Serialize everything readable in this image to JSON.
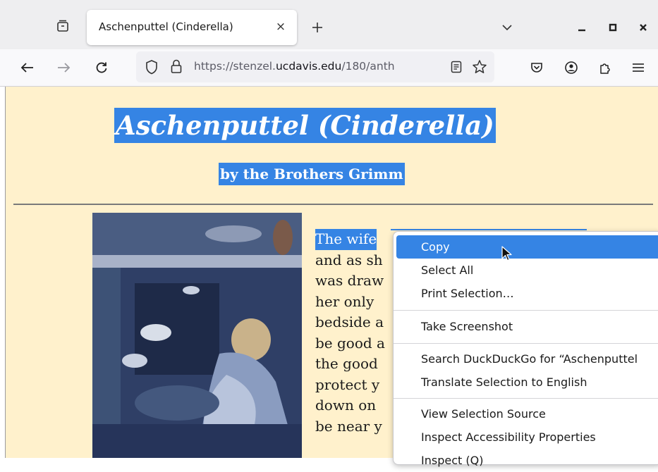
{
  "browser": {
    "tab": {
      "title": "Aschenputtel (Cinderella)",
      "close_glyph": "×"
    },
    "new_tab_glyph": "+",
    "list_all_tabs_glyph": "⌄",
    "url": {
      "prefix": "https://stenzel.",
      "host": "ucdavis.edu",
      "path": "/180/anth"
    }
  },
  "page": {
    "title": "Aschenputtel (Cinderella)",
    "subtitle": "by the Brothers Grimm",
    "story_first_word": "The wife",
    "story_lines": [
      "and as sh",
      "was draw",
      "her only",
      "bedside a",
      "be good a",
      "the good",
      "protect y",
      "down on",
      "be near y"
    ]
  },
  "context_menu": {
    "items": {
      "copy": "Copy",
      "select_all": "Select All",
      "print_selection": "Print Selection…",
      "take_screenshot": "Take Screenshot",
      "search": "Search DuckDuckGo for “Aschenputtel",
      "translate": "Translate Selection to English",
      "view_source": "View Selection Source",
      "inspect_accessibility": "Inspect Accessibility Properties",
      "inspect": "Inspect (Q)"
    }
  },
  "colors": {
    "accent": "#3584e4",
    "page_bg": "#fff1cc",
    "tabbar_bg": "#eeeef0"
  },
  "icons": [
    "tab-overview-icon",
    "back-arrow-icon",
    "forward-arrow-icon",
    "reload-icon",
    "shield-icon",
    "lock-icon",
    "reader-view-icon",
    "bookmark-star-icon",
    "pocket-icon",
    "account-icon",
    "extensions-icon",
    "menu-icon"
  ]
}
